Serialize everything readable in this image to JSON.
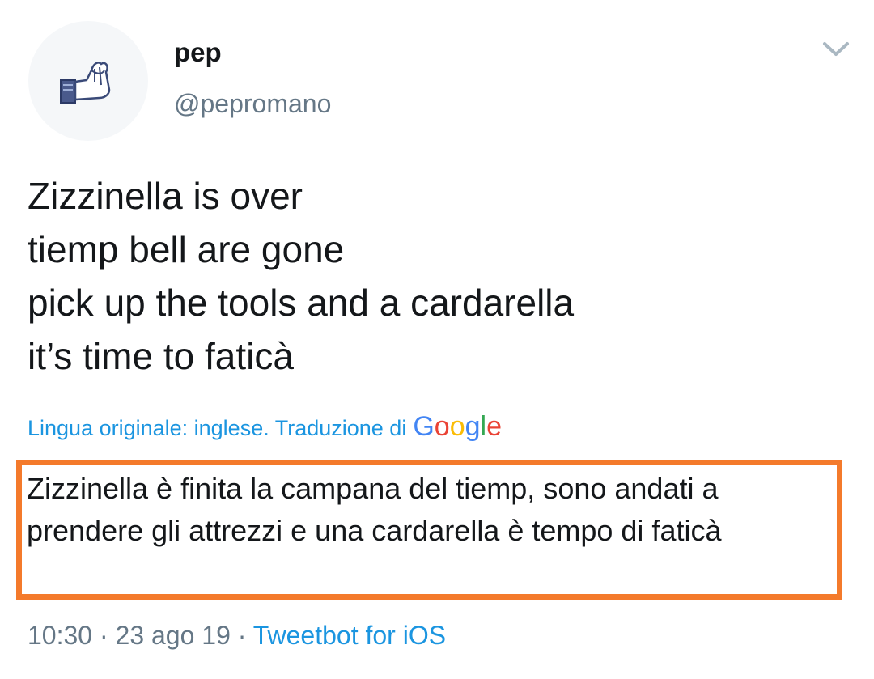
{
  "author": {
    "display_name": "pep",
    "handle": "@pepromano",
    "avatar_icon": "hand-gesture-icon"
  },
  "menu": {
    "icon": "chevron-down-icon"
  },
  "tweet": {
    "lines": [
      "Zizzinella is over",
      "tiemp bell are gone",
      "pick up the tools and a cardarella",
      "it’s time to faticà"
    ]
  },
  "translation": {
    "meta_label": "Lingua originale: inglese. Traduzione di",
    "provider_letters": [
      "G",
      "o",
      "o",
      "g",
      "l",
      "e"
    ],
    "provider_colors": [
      "#4285F4",
      "#EA4335",
      "#FBBC05",
      "#4285F4",
      "#34A853",
      "#EA4335"
    ],
    "text": "Zizzinella è finita la campana del tiemp, sono andati a prendere gli attrezzi e una cardarella è tempo di faticà",
    "highlight_color": "#f47a2b"
  },
  "footer": {
    "time": "10:30",
    "separator": " · ",
    "date": "23 ago 19",
    "source": "Tweetbot for iOS"
  },
  "colors": {
    "link": "#1b95e0",
    "secondary_text": "#657786",
    "primary_text": "#14171a"
  }
}
